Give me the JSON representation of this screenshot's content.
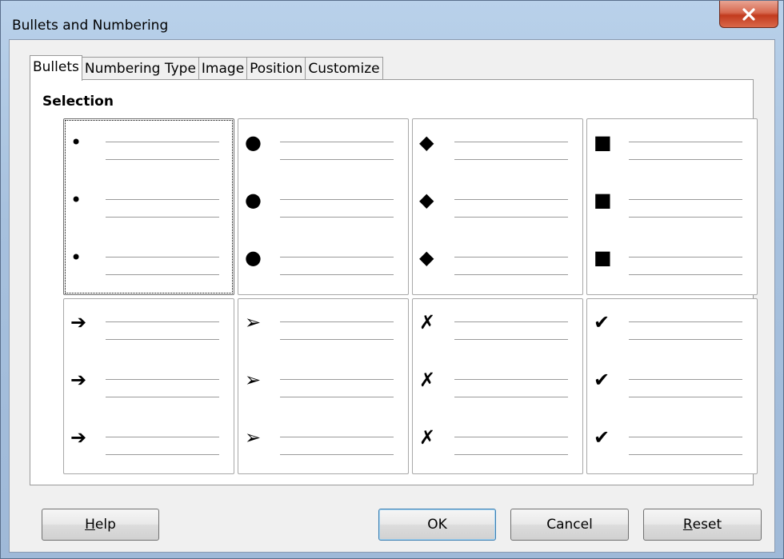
{
  "window": {
    "title": "Bullets and Numbering",
    "close_glyph": "✕"
  },
  "tabs": [
    {
      "label": "Bullets",
      "active": true
    },
    {
      "label": "Numbering Type",
      "active": false
    },
    {
      "label": "Image",
      "active": false
    },
    {
      "label": "Position",
      "active": false
    },
    {
      "label": "Customize",
      "active": false
    }
  ],
  "section": {
    "label": "Selection"
  },
  "bullet_styles": [
    {
      "name": "small-dot",
      "glyph": "•",
      "selected": true
    },
    {
      "name": "large-dot",
      "glyph": "●",
      "selected": false
    },
    {
      "name": "diamond",
      "glyph": "◆",
      "selected": false
    },
    {
      "name": "square",
      "glyph": "■",
      "selected": false
    },
    {
      "name": "bold-arrow",
      "glyph": "➔",
      "selected": false
    },
    {
      "name": "arrowhead",
      "glyph": "➢",
      "selected": false
    },
    {
      "name": "cross",
      "glyph": "✗",
      "selected": false
    },
    {
      "name": "checkmark",
      "glyph": "✔",
      "selected": false
    }
  ],
  "buttons": {
    "help": {
      "prefix": "",
      "mnemonic": "H",
      "rest": "elp"
    },
    "ok": "OK",
    "cancel": "Cancel",
    "reset": {
      "prefix": "",
      "mnemonic": "R",
      "rest": "eset"
    }
  }
}
